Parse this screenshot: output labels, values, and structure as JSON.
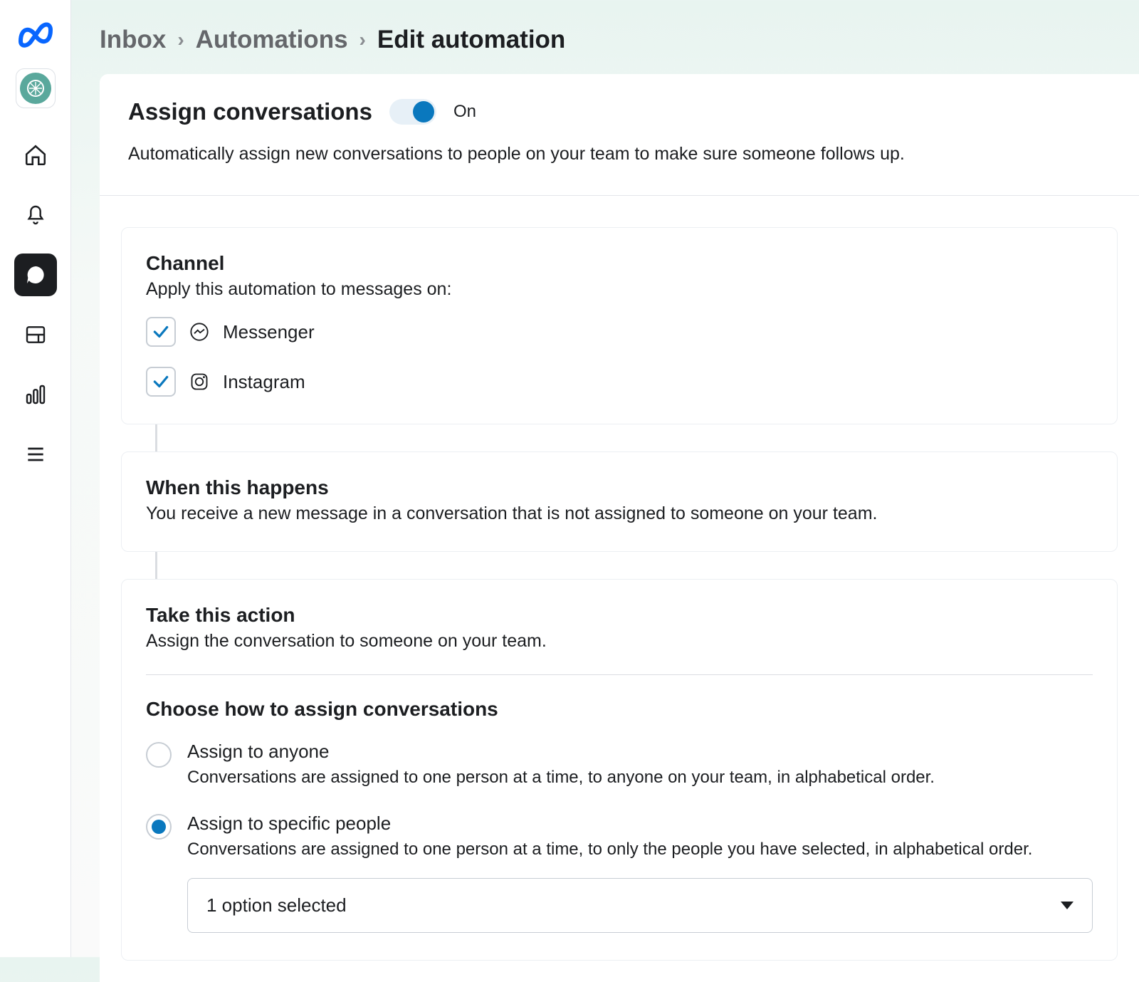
{
  "breadcrumb": {
    "level1": "Inbox",
    "level2": "Automations",
    "current": "Edit automation"
  },
  "header": {
    "title": "Assign conversations",
    "toggle_state": "On",
    "description": "Automatically assign new conversations to people on your team to make sure someone follows up."
  },
  "channel": {
    "title": "Channel",
    "subtitle": "Apply this automation to messages on:",
    "items": [
      {
        "label": "Messenger",
        "checked": true,
        "icon": "messenger-icon"
      },
      {
        "label": "Instagram",
        "checked": true,
        "icon": "instagram-icon"
      }
    ]
  },
  "trigger": {
    "title": "When this happens",
    "description": "You receive a new message in a conversation that is not assigned to someone on your team."
  },
  "action": {
    "title": "Take this action",
    "description": "Assign the conversation to someone on your team.",
    "choose_title": "Choose how to assign conversations",
    "options": [
      {
        "title": "Assign to anyone",
        "desc": "Conversations are assigned to one person at a time, to anyone on your team, in alphabetical order.",
        "selected": false
      },
      {
        "title": "Assign to specific people",
        "desc": "Conversations are assigned to one person at a time, to only the people you have selected, in alphabetical order.",
        "selected": true
      }
    ],
    "select_value": "1 option selected"
  }
}
